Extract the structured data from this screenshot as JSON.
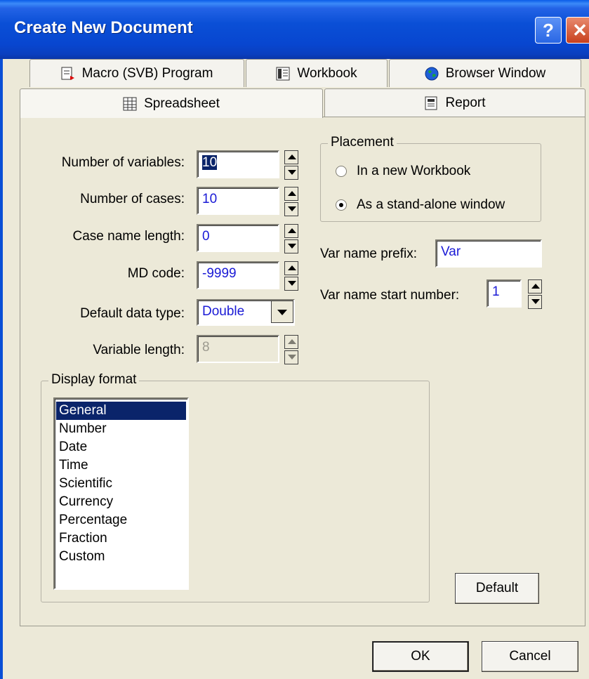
{
  "window": {
    "title": "Create New Document"
  },
  "tabs": [
    {
      "label": "Macro (SVB) Program",
      "icon": "macro-icon"
    },
    {
      "label": "Workbook",
      "icon": "workbook-icon"
    },
    {
      "label": "Browser Window",
      "icon": "globe-icon"
    },
    {
      "label": "Spreadsheet",
      "icon": "spreadsheet-icon",
      "active": true
    },
    {
      "label": "Report",
      "icon": "report-icon"
    }
  ],
  "form": {
    "num_vars_label": "Number of variables:",
    "num_vars_value": "10",
    "num_cases_label": "Number of cases:",
    "num_cases_value": "10",
    "case_name_label": "Case name length:",
    "case_name_value": "0",
    "md_code_label": "MD code:",
    "md_code_value": "-9999",
    "data_type_label": "Default data type:",
    "data_type_value": "Double",
    "var_length_label": "Variable length:",
    "var_length_value": "8"
  },
  "placement": {
    "legend": "Placement",
    "option_workbook": "In a new Workbook",
    "option_standalone": "As a stand-alone window",
    "selected": "As a stand-alone window"
  },
  "prefix": {
    "label": "Var name prefix:",
    "value": "Var",
    "start_label": "Var name start number:",
    "start_value": "1"
  },
  "display_format": {
    "legend": "Display format",
    "items": [
      "General",
      "Number",
      "Date",
      "Time",
      "Scientific",
      "Currency",
      "Percentage",
      "Fraction",
      "Custom"
    ],
    "selected": "General"
  },
  "buttons": {
    "default": "Default",
    "ok": "OK",
    "cancel": "Cancel"
  }
}
